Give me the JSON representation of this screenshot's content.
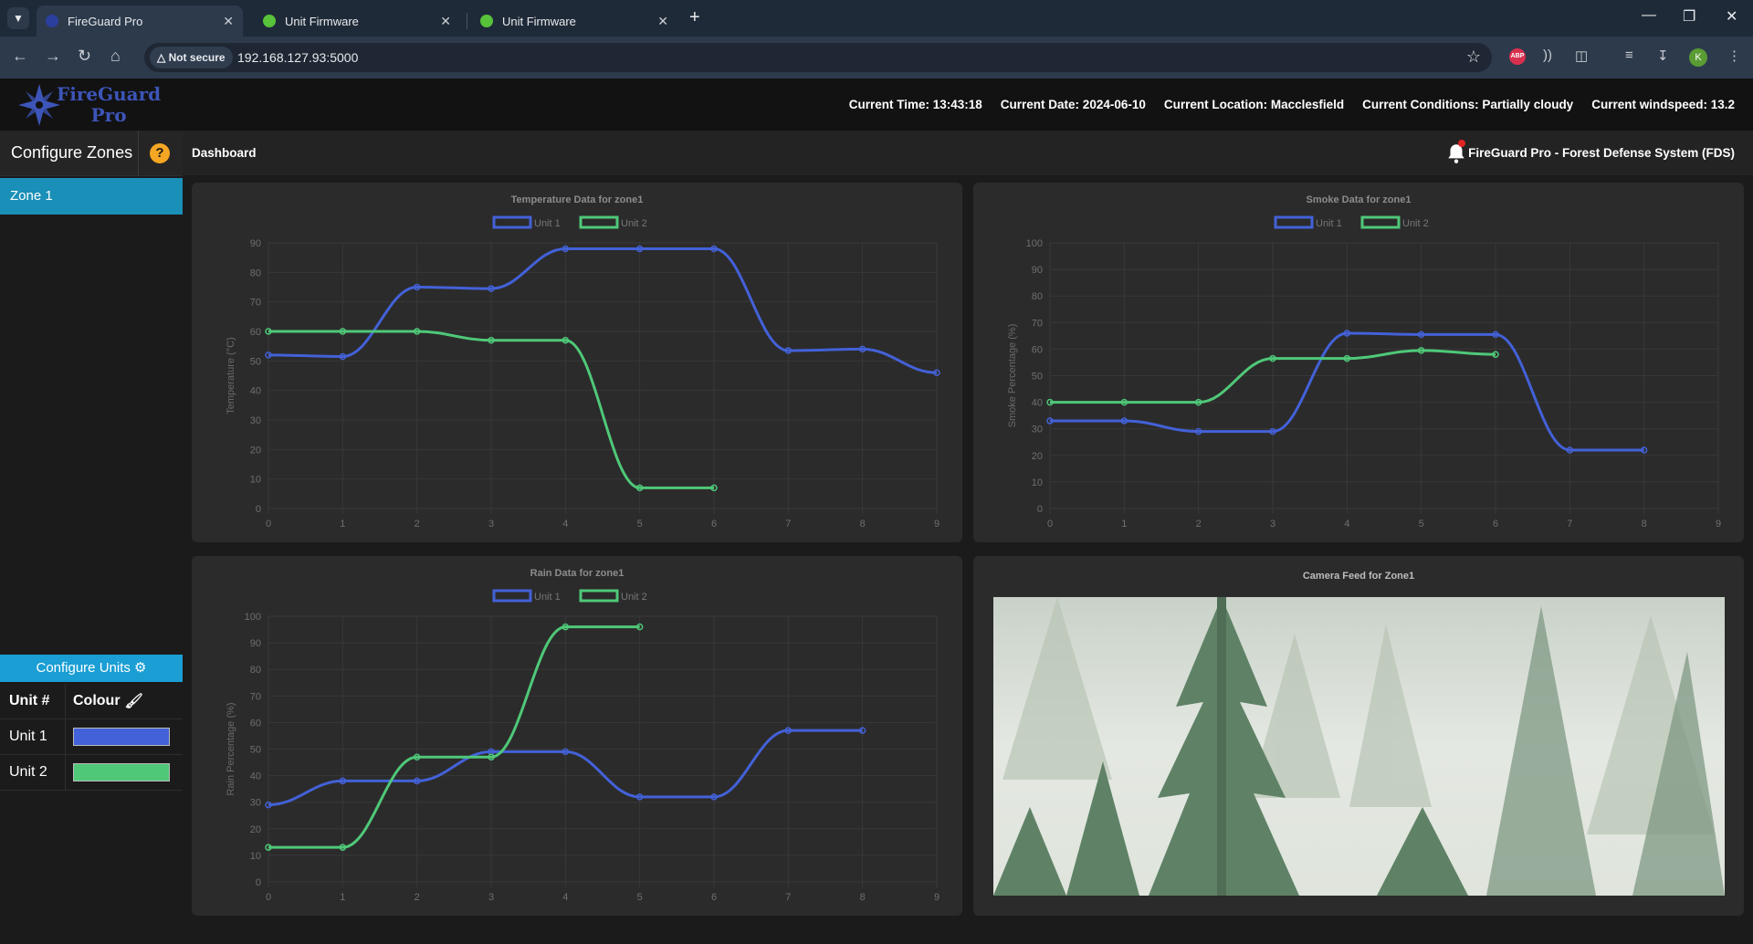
{
  "browser": {
    "tabs": [
      {
        "title": "FireGuard Pro",
        "active": true,
        "favicon": "fireguard-favicon"
      },
      {
        "title": "Unit Firmware",
        "active": false,
        "favicon": "green-globe-favicon"
      },
      {
        "title": "Unit Firmware",
        "active": false,
        "favicon": "green-globe-favicon"
      }
    ],
    "security_label": "Not secure",
    "url": "192.168.127.93:5000",
    "profile_initial": "K",
    "adblock_label": "ABP"
  },
  "header": {
    "logo_line1": "FireGuard",
    "logo_line2": "Pro",
    "current_time": "Current Time: 13:43:18",
    "current_date": "Current Date: 2024-06-10",
    "current_location": "Current Location: Macclesfield",
    "current_conditions": "Current Conditions: Partially cloudy",
    "current_windspeed": "Current windspeed: 13.2"
  },
  "sidebar": {
    "title": "Configure Zones",
    "help_glyph": "?",
    "zones": [
      "Zone 1"
    ],
    "configure_units_label": "Configure Units",
    "table_headers": {
      "unit": "Unit #",
      "colour": "Colour"
    },
    "units": [
      {
        "name": "Unit 1",
        "colour": "#4361d8"
      },
      {
        "name": "Unit 2",
        "colour": "#4fc878"
      }
    ]
  },
  "dashboard": {
    "title": "Dashboard",
    "system_title": "FireGuard Pro - Forest Defense System (FDS)"
  },
  "camera": {
    "title": "Camera Feed for Zone1"
  },
  "chart_data": [
    {
      "type": "line",
      "title": "Temperature Data for zone1",
      "ylabel": "Temperature (°C)",
      "xlabel": "",
      "x": [
        0,
        1,
        2,
        3,
        4,
        5,
        6,
        7,
        8,
        9
      ],
      "ylim": [
        0,
        90
      ],
      "yticks": [
        0,
        10,
        20,
        30,
        40,
        50,
        60,
        70,
        80,
        90
      ],
      "grid": true,
      "legend": "top-center",
      "series": [
        {
          "name": "Unit 1",
          "color": "#4361d8",
          "values": [
            52,
            51.5,
            75,
            74.5,
            88,
            88,
            88,
            53.5,
            54,
            46
          ]
        },
        {
          "name": "Unit 2",
          "color": "#4fc878",
          "values": [
            60,
            60,
            60,
            57,
            57,
            7,
            7,
            null,
            null,
            null
          ]
        }
      ]
    },
    {
      "type": "line",
      "title": "Smoke Data for zone1",
      "ylabel": "Smoke Percentage (%)",
      "xlabel": "",
      "x": [
        0,
        1,
        2,
        3,
        4,
        5,
        6,
        7,
        8,
        9
      ],
      "ylim": [
        0,
        100
      ],
      "yticks": [
        0,
        10,
        20,
        30,
        40,
        50,
        60,
        70,
        80,
        90,
        100
      ],
      "grid": true,
      "legend": "top-center",
      "series": [
        {
          "name": "Unit 1",
          "color": "#4361d8",
          "values": [
            33,
            33,
            29,
            29,
            66,
            65.5,
            65.5,
            22,
            22,
            null
          ]
        },
        {
          "name": "Unit 2",
          "color": "#4fc878",
          "values": [
            40,
            40,
            40,
            56.5,
            56.5,
            59.5,
            58,
            null,
            null,
            null
          ]
        }
      ]
    },
    {
      "type": "line",
      "title": "Rain Data for zone1",
      "ylabel": "Rain Percentage (%)",
      "xlabel": "",
      "x": [
        0,
        1,
        2,
        3,
        4,
        5,
        6,
        7,
        8,
        9
      ],
      "ylim": [
        0,
        100
      ],
      "yticks": [
        0,
        10,
        20,
        30,
        40,
        50,
        60,
        70,
        80,
        90,
        100
      ],
      "grid": true,
      "legend": "top-center",
      "series": [
        {
          "name": "Unit 1",
          "color": "#4361d8",
          "values": [
            29,
            38,
            38,
            49,
            49,
            32,
            32,
            57,
            57,
            null
          ]
        },
        {
          "name": "Unit 2",
          "color": "#4fc878",
          "values": [
            13,
            13,
            47,
            47,
            96,
            96,
            null,
            null,
            null,
            null
          ]
        }
      ]
    }
  ]
}
